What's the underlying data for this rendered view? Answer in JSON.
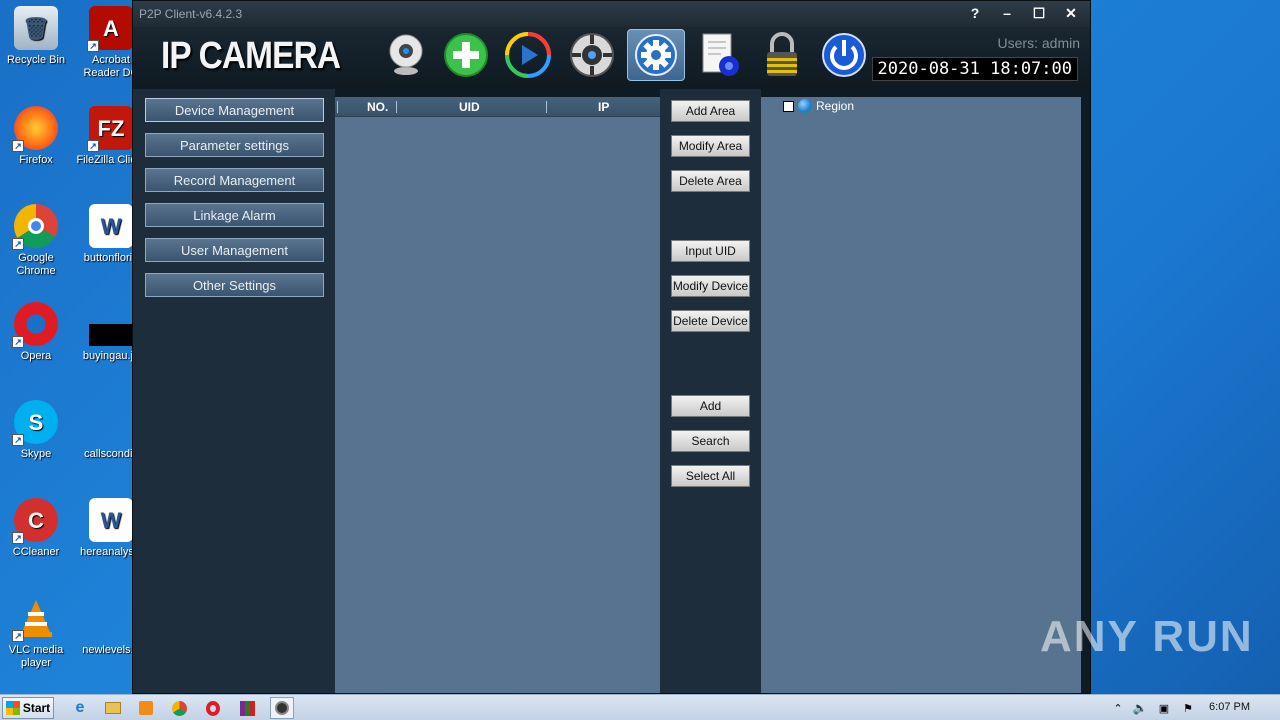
{
  "desktop": {
    "icons": [
      {
        "label": "Recycle Bin"
      },
      {
        "label": "Acrobat Reader DC"
      },
      {
        "label": "Firefox"
      },
      {
        "label": "FileZilla Client"
      },
      {
        "label": "Google Chrome"
      },
      {
        "label": "buttonflorid"
      },
      {
        "label": "Opera"
      },
      {
        "label": "buyingau.jp"
      },
      {
        "label": "Skype"
      },
      {
        "label": "callsconditi"
      },
      {
        "label": "CCleaner"
      },
      {
        "label": "hereanalysis"
      },
      {
        "label": "VLC media player"
      },
      {
        "label": "newlevels.p"
      }
    ]
  },
  "window": {
    "title": "P2P Client-v6.4.2.3",
    "controls": [
      "?",
      "–",
      "☐",
      "✕"
    ],
    "brand": "IP CAMERA",
    "user_label": "Users: admin",
    "datetime": "2020-08-31  18:07:00"
  },
  "nav": {
    "items": [
      {
        "label": "Device Management"
      },
      {
        "label": "Parameter settings"
      },
      {
        "label": "Record Management"
      },
      {
        "label": "Linkage Alarm"
      },
      {
        "label": "User Management"
      },
      {
        "label": "Other Settings"
      }
    ]
  },
  "device_list": {
    "columns": [
      "NO.",
      "UID",
      "IP"
    ]
  },
  "actions": {
    "add_area": "Add Area",
    "modify_area": "Modify Area",
    "delete_area": "Delete Area",
    "input_uid": "Input UID",
    "modify_device": "Modify Device",
    "delete_device": "Delete Device",
    "add": "Add",
    "search": "Search",
    "select_all": "Select All"
  },
  "region": {
    "root_label": "Region"
  },
  "watermark": "ANY RUN",
  "taskbar": {
    "start_label": "Start",
    "time": "6:07 PM"
  },
  "colors": {
    "desktop_bg": "#1e83d8",
    "app_bg": "#1d2d3b",
    "panel_bg": "#57738f",
    "active_toolbar": "#3d6690"
  }
}
